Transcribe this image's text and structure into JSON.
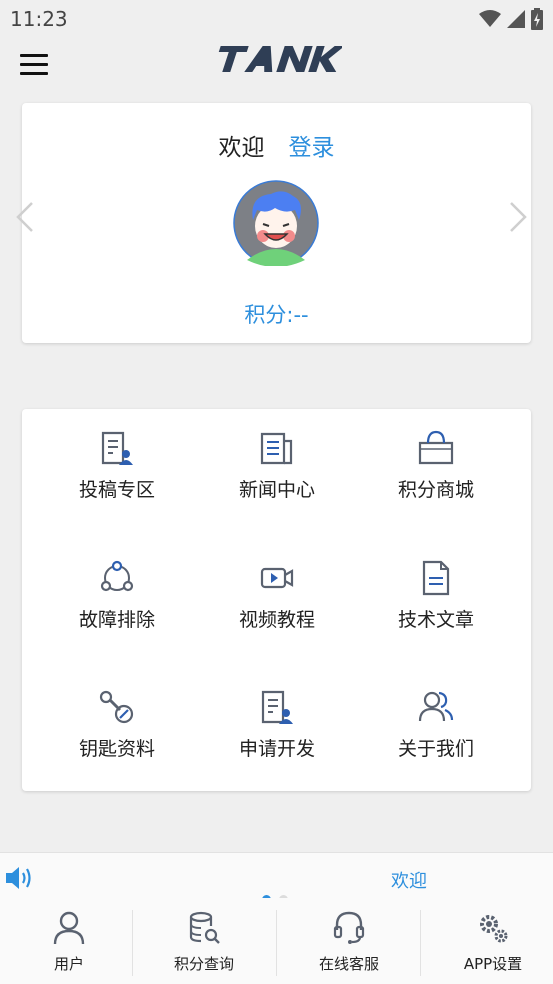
{
  "status_bar": {
    "time": "11:23"
  },
  "header": {
    "logo_text": "TANK"
  },
  "welcome_card": {
    "greeting": "欢迎",
    "login_link": "登录",
    "points_text": "积分:--"
  },
  "menu_items": [
    {
      "label": "投稿专区",
      "icon": "document-user-icon"
    },
    {
      "label": "新闻中心",
      "icon": "newspaper-icon"
    },
    {
      "label": "积分商城",
      "icon": "shopping-bag-icon"
    },
    {
      "label": "故障排除",
      "icon": "troubleshoot-icon"
    },
    {
      "label": "视频教程",
      "icon": "video-icon"
    },
    {
      "label": "技术文章",
      "icon": "article-icon"
    },
    {
      "label": "钥匙资料",
      "icon": "key-icon"
    },
    {
      "label": "申请开发",
      "icon": "apply-document-icon"
    },
    {
      "label": "关于我们",
      "icon": "users-icon"
    }
  ],
  "notice": {
    "text": "欢迎",
    "active_dot": 0,
    "dot_count": 2
  },
  "tabs": [
    {
      "label": "用户",
      "icon": "user-icon"
    },
    {
      "label": "积分查询",
      "icon": "database-search-icon"
    },
    {
      "label": "在线客服",
      "icon": "headset-icon"
    },
    {
      "label": "APP设置",
      "icon": "gear-icon"
    }
  ],
  "colors": {
    "accent": "#2d8fdd",
    "icon_gray": "#5a6270",
    "icon_blue": "#2e5fb0",
    "background": "#efefef"
  }
}
